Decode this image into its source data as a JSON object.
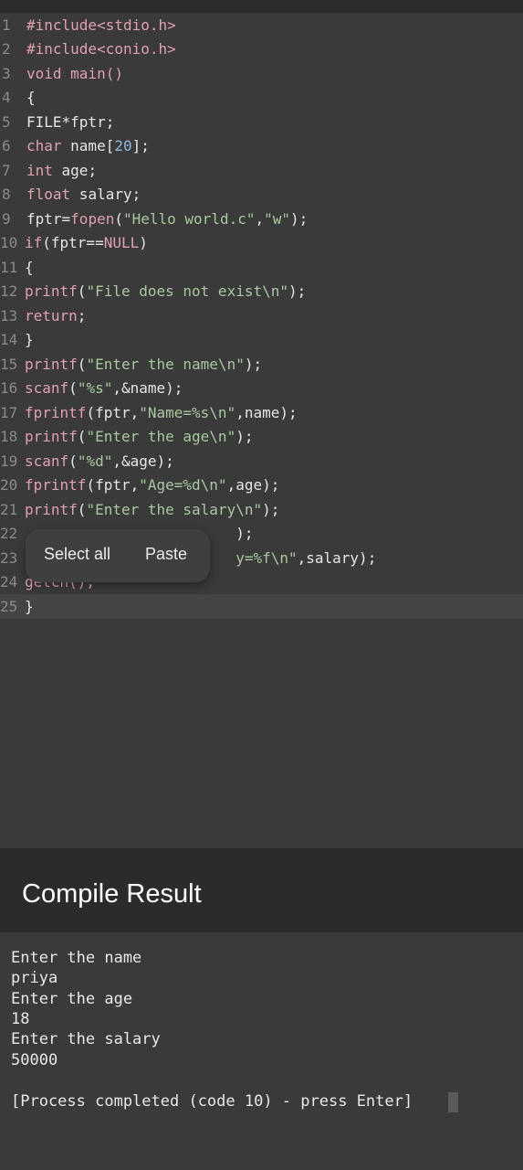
{
  "editor": {
    "lines": [
      {
        "n": "1",
        "parts": [
          [
            "#include<stdio.h>",
            "kw"
          ]
        ]
      },
      {
        "n": "2",
        "parts": [
          [
            "#include<conio.h>",
            "kw"
          ]
        ]
      },
      {
        "n": "3",
        "parts": [
          [
            "void",
            "kw"
          ],
          [
            " main()",
            "kw"
          ]
        ]
      },
      {
        "n": "4",
        "parts": [
          [
            "{",
            ""
          ]
        ]
      },
      {
        "n": "5",
        "parts": [
          [
            "FILE*fptr;",
            ""
          ]
        ]
      },
      {
        "n": "6",
        "parts": [
          [
            "char",
            "kw"
          ],
          [
            " name[",
            ""
          ],
          [
            "20",
            "num"
          ],
          [
            "];",
            ""
          ]
        ]
      },
      {
        "n": "7",
        "parts": [
          [
            "int",
            "kw"
          ],
          [
            " age;",
            ""
          ]
        ]
      },
      {
        "n": "8",
        "parts": [
          [
            "float",
            "kw"
          ],
          [
            " salary;",
            ""
          ]
        ]
      },
      {
        "n": "9",
        "parts": [
          [
            "fptr=",
            ""
          ],
          [
            "fopen",
            "kw"
          ],
          [
            "(",
            ""
          ],
          [
            "\"Hello world.c\"",
            "str"
          ],
          [
            ",",
            ""
          ],
          [
            "\"w\"",
            "str"
          ],
          [
            ");",
            ""
          ]
        ]
      },
      {
        "n": "10",
        "parts": [
          [
            "if",
            "kw"
          ],
          [
            "(fptr==",
            ""
          ],
          [
            "NULL",
            "kw"
          ],
          [
            ")",
            ""
          ]
        ]
      },
      {
        "n": "11",
        "parts": [
          [
            "{",
            ""
          ]
        ]
      },
      {
        "n": "12",
        "parts": [
          [
            "printf",
            "kw"
          ],
          [
            "(",
            ""
          ],
          [
            "\"File does not exist\\n\"",
            "str"
          ],
          [
            ");",
            ""
          ]
        ]
      },
      {
        "n": "13",
        "parts": [
          [
            "return",
            "kw"
          ],
          [
            ";",
            ""
          ]
        ]
      },
      {
        "n": "14",
        "parts": [
          [
            "}",
            ""
          ]
        ]
      },
      {
        "n": "15",
        "parts": [
          [
            "printf",
            "kw"
          ],
          [
            "(",
            ""
          ],
          [
            "\"Enter the name\\n\"",
            "str"
          ],
          [
            ");",
            ""
          ]
        ]
      },
      {
        "n": "16",
        "parts": [
          [
            "scanf",
            "kw"
          ],
          [
            "(",
            ""
          ],
          [
            "\"%s\"",
            "str"
          ],
          [
            ",&name);",
            ""
          ]
        ]
      },
      {
        "n": "17",
        "parts": [
          [
            "fprintf",
            "kw"
          ],
          [
            "(fptr,",
            ""
          ],
          [
            "\"Name=%s\\n\"",
            "str"
          ],
          [
            ",name);",
            ""
          ]
        ]
      },
      {
        "n": "18",
        "parts": [
          [
            "printf",
            "kw"
          ],
          [
            "(",
            ""
          ],
          [
            "\"Enter the age\\n\"",
            "str"
          ],
          [
            ");",
            ""
          ]
        ]
      },
      {
        "n": "19",
        "parts": [
          [
            "scanf",
            "kw"
          ],
          [
            "(",
            ""
          ],
          [
            "\"%d\"",
            "str"
          ],
          [
            ",&age);",
            ""
          ]
        ]
      },
      {
        "n": "20",
        "parts": [
          [
            "fprintf",
            "kw"
          ],
          [
            "(fptr,",
            ""
          ],
          [
            "\"Age=%d\\n\"",
            "str"
          ],
          [
            ",age);",
            ""
          ]
        ]
      },
      {
        "n": "21",
        "parts": [
          [
            "printf",
            "kw"
          ],
          [
            "(",
            ""
          ],
          [
            "\"Enter the salary\\n\"",
            "str"
          ],
          [
            ");",
            ""
          ]
        ]
      },
      {
        "n": "22",
        "parts": [
          [
            "                        );",
            ""
          ]
        ]
      },
      {
        "n": "23",
        "parts": [
          [
            "                        ",
            ""
          ],
          [
            "y=%f\\n\"",
            "str"
          ],
          [
            ",salary);",
            ""
          ]
        ]
      },
      {
        "n": "24",
        "parts": [
          [
            "getch();",
            "kw"
          ]
        ]
      },
      {
        "n": "25",
        "parts": [
          [
            "}",
            ""
          ]
        ]
      }
    ],
    "current_line": "25"
  },
  "context_menu": {
    "select_all": "Select all",
    "paste": "Paste"
  },
  "result": {
    "title": "Compile Result",
    "output": [
      "Enter the name",
      "priya",
      "Enter the age",
      "18",
      "Enter the salary",
      "50000",
      "",
      "[Process completed (code 10) - press Enter]"
    ]
  }
}
